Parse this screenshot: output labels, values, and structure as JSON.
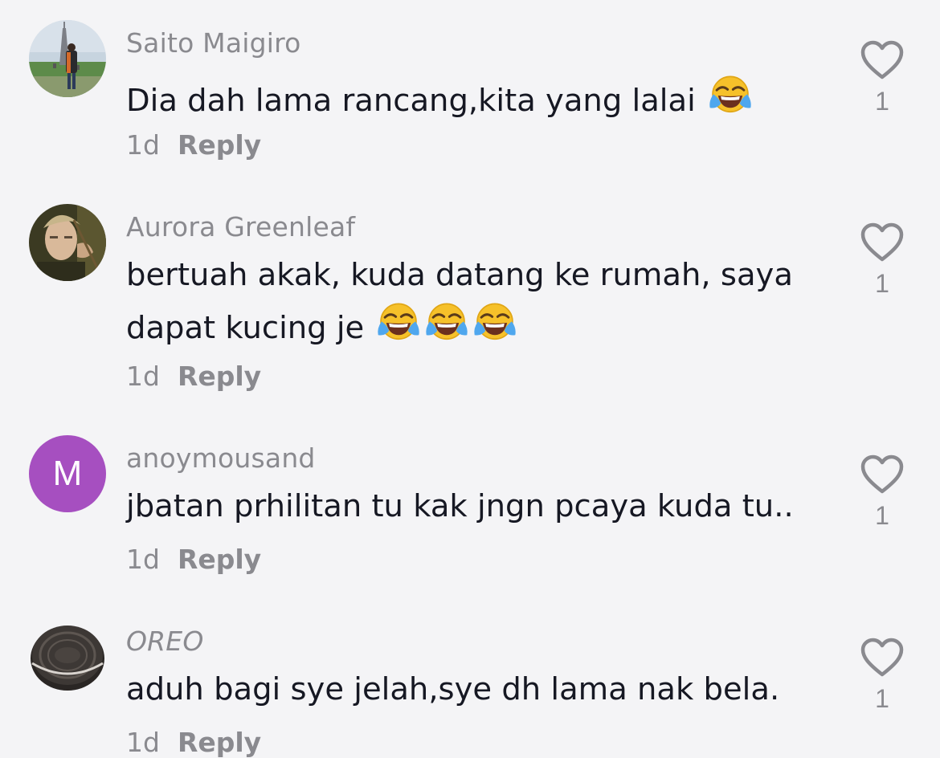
{
  "comments": [
    {
      "username": "Saito Maigiro",
      "text": "Dia dah lama rancang,kita yang lalai",
      "emoji": [
        "face-with-tears-of-joy"
      ],
      "time": "1d",
      "reply_label": "Reply",
      "likes": "1"
    },
    {
      "username": "Aurora Greenleaf",
      "text": "bertuah akak, kuda datang ke rumah, saya dapat kucing je",
      "emoji": [
        "face-with-tears-of-joy",
        "face-with-tears-of-joy",
        "face-with-tears-of-joy"
      ],
      "time": "1d",
      "reply_label": "Reply",
      "likes": "1"
    },
    {
      "username": "anoymousand",
      "avatar_letter": "M",
      "avatar_color": "#a64fc0",
      "text": "jbatan prhilitan tu kak jngn pcaya kuda tu..",
      "time": "1d",
      "reply_label": "Reply",
      "likes": "1"
    },
    {
      "username": "OREO",
      "text": "aduh bagi sye jelah,sye dh lama nak bela.",
      "time": "1d",
      "reply_label": "Reply",
      "likes": "1"
    }
  ],
  "icons": {
    "like": "heart-outline-icon",
    "emoji": "face-with-tears-of-joy"
  },
  "colors": {
    "background": "#f4f4f6",
    "text_primary": "#161823",
    "text_secondary": "#8a8a8f"
  }
}
